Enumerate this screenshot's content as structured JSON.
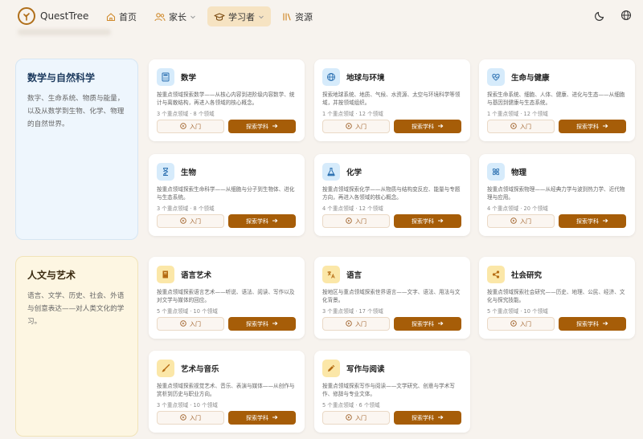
{
  "brand": {
    "name": "QuestTree"
  },
  "nav": {
    "items": [
      {
        "label": "首页",
        "icon": "home-icon"
      },
      {
        "label": "家长",
        "icon": "parents-icon"
      },
      {
        "label": "学习者",
        "icon": "graduation-cap-icon",
        "active": true
      },
      {
        "label": "资源",
        "icon": "library-icon"
      }
    ]
  },
  "header_actions": {
    "theme_icon": "moon-icon",
    "language_icon": "globe-icon"
  },
  "colors": {
    "accent": "#a65d08",
    "active_nav_bg": "#f6e3c2",
    "science_panel": "#eef6fd",
    "arts_panel": "#fdf6e2"
  },
  "categories": [
    {
      "title": "数学与自然科学",
      "description": "数字、生命系统、物质与能量，以及从数学到生物、化学、物理的自然世界。"
    },
    {
      "title": "人文与艺术",
      "description": "语言、文学、历史、社会、外语与创意表达——对人类文化的学习。"
    }
  ],
  "buttons": {
    "intro": "入门",
    "explore": "探索学科"
  },
  "subjects": [
    {
      "name": "数学",
      "icon": "calculator-icon",
      "description": "按重点领域探索数学——从核心内容到进阶级内容数学、统计与离散结构，再进入各领域的核心概念。",
      "meta": "3 个重点领域 · 8 个领域"
    },
    {
      "name": "地球与环境",
      "icon": "globe-icon",
      "description": "探索地球系统、地质、气候、水资源、太空与环境科学等领域，并按领域组织。",
      "meta": "1 个重点领域 · 12 个领域"
    },
    {
      "name": "生命与健康",
      "icon": "heart-pulse-icon",
      "description": "探索生命系统、细胞、人体、健康、进化与生态——从细胞与基因到健康与生态系统。",
      "meta": "1 个重点领域 · 12 个领域"
    },
    {
      "name": "生物",
      "icon": "hourglass-icon",
      "description": "按重点领域探索生命科学——从细胞与分子到生物体、进化与生态系统。",
      "meta": "3 个重点领域 · 8 个领域"
    },
    {
      "name": "化学",
      "icon": "flask-icon",
      "description": "按重点领域探索化学——从物质与结构变反应、能量与专题方向，再进入各领域的核心概念。",
      "meta": "4 个重点领域 · 12 个领域"
    },
    {
      "name": "物理",
      "icon": "atom-icon",
      "description": "按重点领域探索物理——从经典力学与波到热力学、近代物理与应用。",
      "meta": "4 个重点领域 · 20 个领域"
    },
    {
      "name": "语言艺术",
      "icon": "book-icon",
      "description": "按重点领域探索语言艺术——听说、语法、阅读、写作以及对文学与媒体的回应。",
      "meta": "5 个重点领域 · 10 个领域"
    },
    {
      "name": "语言",
      "icon": "translate-icon",
      "description": "按地区与重点领域探索世界语言——文字、语法、用法与文化背景。",
      "meta": "3 个重点领域 · 17 个领域"
    },
    {
      "name": "社会研究",
      "icon": "share-icon",
      "description": "按重点领域探索社会研究——历史、地理、公民、经济、文化与探究技能。",
      "meta": "5 个重点领域 · 10 个领域"
    },
    {
      "name": "艺术与音乐",
      "icon": "brush-icon",
      "description": "按重点领域探索视觉艺术、音乐、表演与媒体——从创作与赏析到历史与职业方向。",
      "meta": "3 个重点领域 · 10 个领域"
    },
    {
      "name": "写作与阅读",
      "icon": "pencil-icon",
      "description": "按重点领域探索写作与阅读——文学研究、创意与学术写作、修辞与专业文体。",
      "meta": "5 个重点领域 · 6 个领域"
    }
  ]
}
